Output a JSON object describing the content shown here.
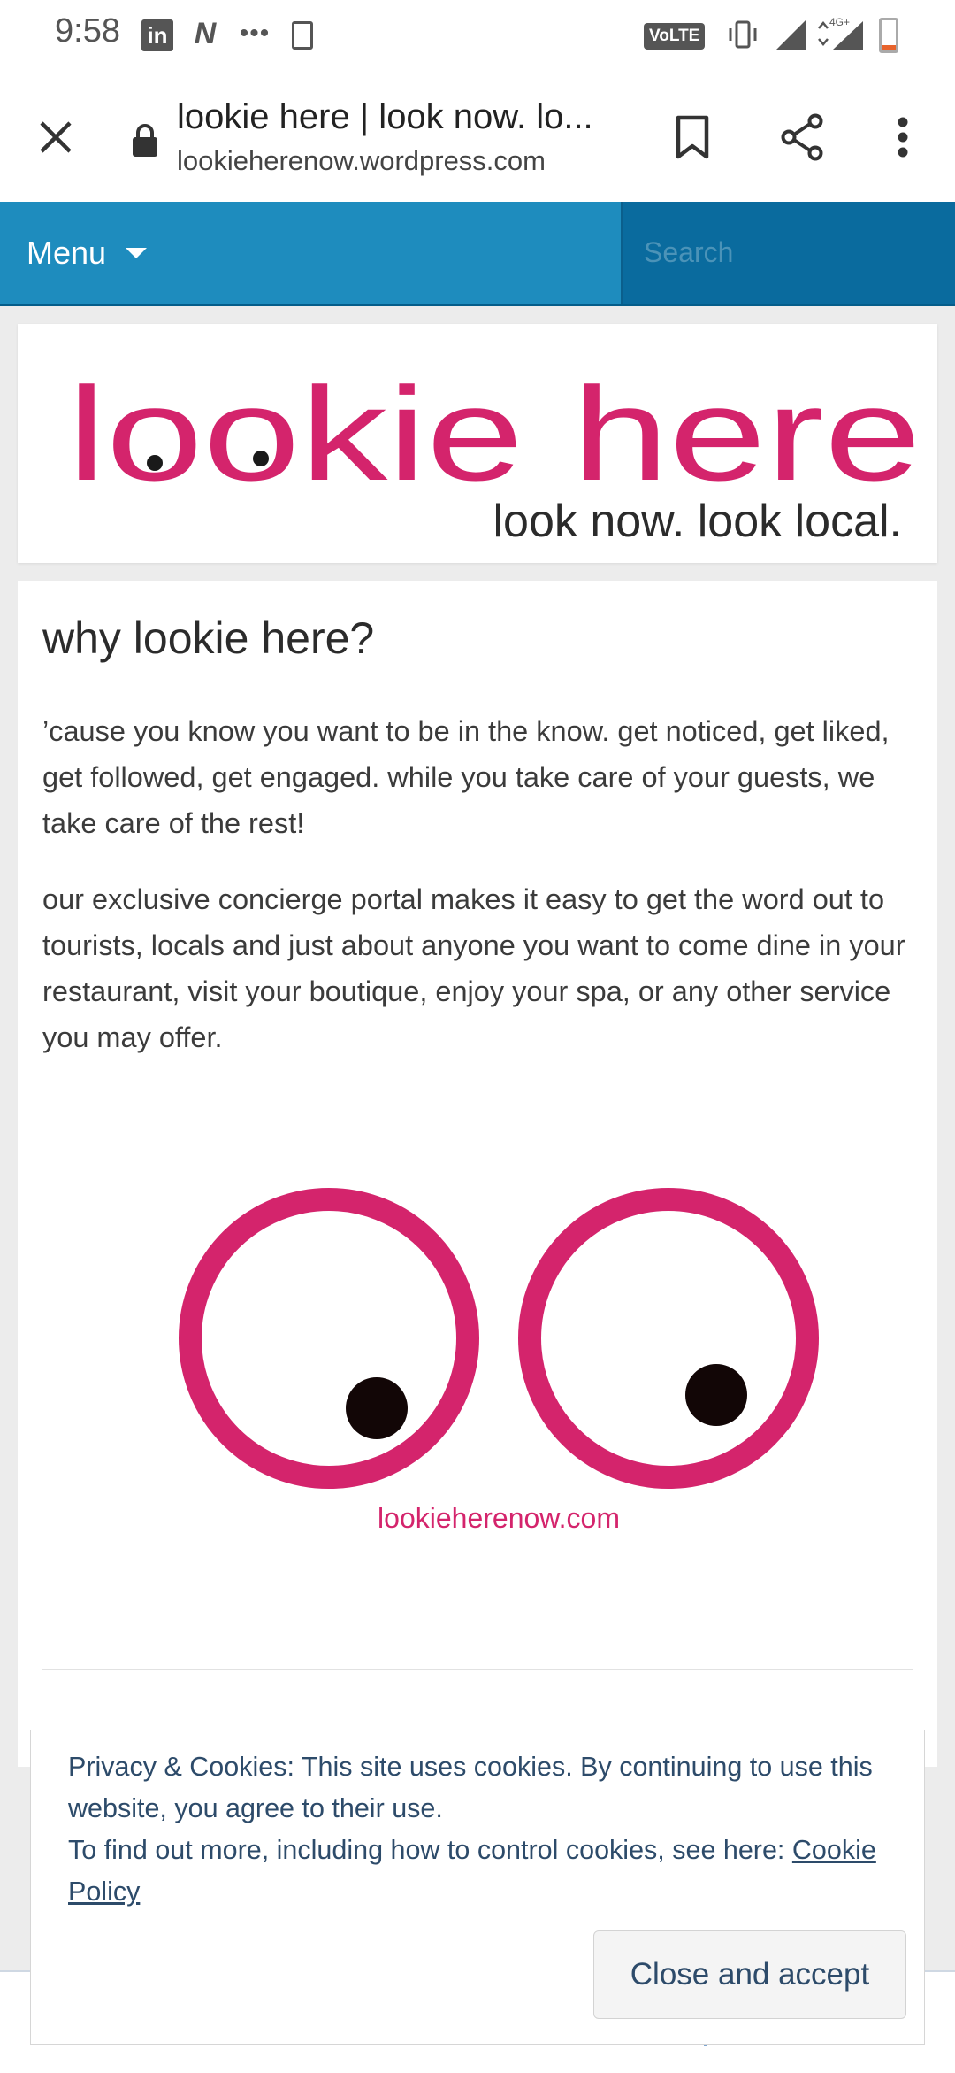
{
  "status_bar": {
    "time": "9:58",
    "icons": [
      "linkedin-icon",
      "n-icon",
      "more-dots-icon",
      "download-icon",
      "volte-icon",
      "vibrate-icon",
      "signal-icon",
      "signal-4g-icon",
      "battery-icon"
    ],
    "linkedin_label": "in",
    "volte_label": "VoLTE",
    "battery_level": 0.18
  },
  "browser": {
    "page_title": "lookie here | look now. lo...",
    "domain": "lookieherenow.wordpress.com"
  },
  "nav": {
    "menu_label": "Menu",
    "search_placeholder": "Search"
  },
  "header": {
    "logo_text": "lookie here",
    "tagline": "look now. look local.",
    "brand_color": "#d4246c"
  },
  "post": {
    "title": "why lookie here?",
    "paragraphs": [
      "’cause you know you want to be in the know. get noticed, get liked, get followed, get engaged. while you take care of your guests, we take care of the rest!",
      "our exclusive concierge portal makes it easy to get the word out to tourists, locals and just about anyone you want to come dine in your restaurant, visit your boutique, enjoy your spa, or any other service you may offer."
    ],
    "image_caption": "lookieherenow.com"
  },
  "cookie_banner": {
    "line1": "Privacy & Cookies: This site uses cookies. By continuing to use this website, you agree to their use.",
    "line2_prefix": "To find out more, including how to control cookies, see here: ",
    "link_text": "Cookie Policy",
    "accept_label": "Close and accept"
  },
  "colors": {
    "nav_blue": "#1e8cbe",
    "search_blue": "#0a6b9e",
    "brand_pink": "#d4246c",
    "cookie_text": "#2d4b6a"
  }
}
